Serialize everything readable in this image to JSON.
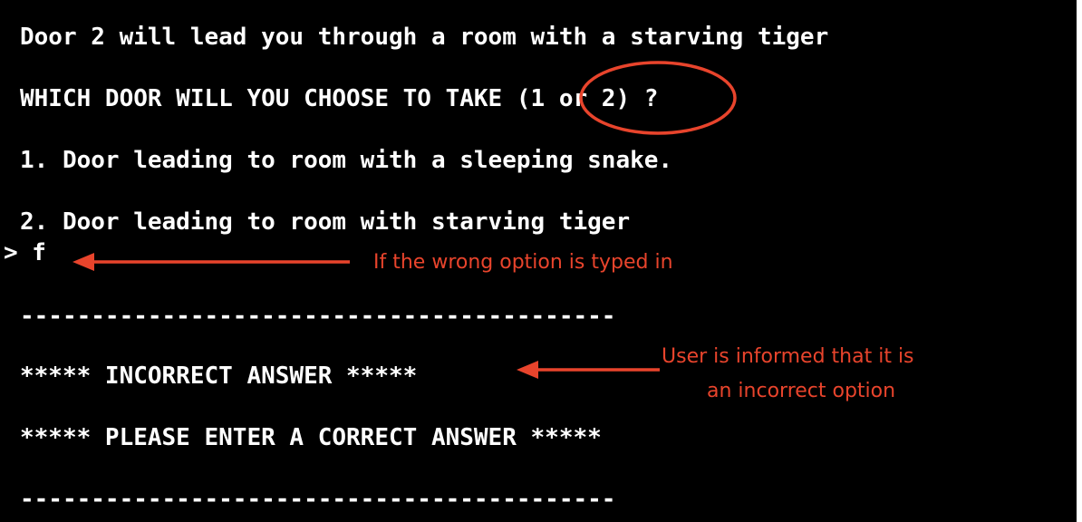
{
  "terminal": {
    "lines": [
      "Door 2 will lead you through a room with a starving tiger",
      "WHICH DOOR WILL YOU CHOOSE TO TAKE (1 or 2) ?",
      "1. Door leading to room with a sleeping snake.",
      "2. Door leading to room with starving tiger",
      "> f",
      "------------------------------------------",
      "***** INCORRECT ANSWER *****",
      "***** PLEASE ENTER A CORRECT ANSWER *****",
      "------------------------------------------"
    ]
  },
  "annotations": {
    "wrong_option": "If the wrong option is typed in",
    "informed_line1": "User is informed that it is",
    "informed_line2": "an incorrect option",
    "color": "#e8442c"
  }
}
